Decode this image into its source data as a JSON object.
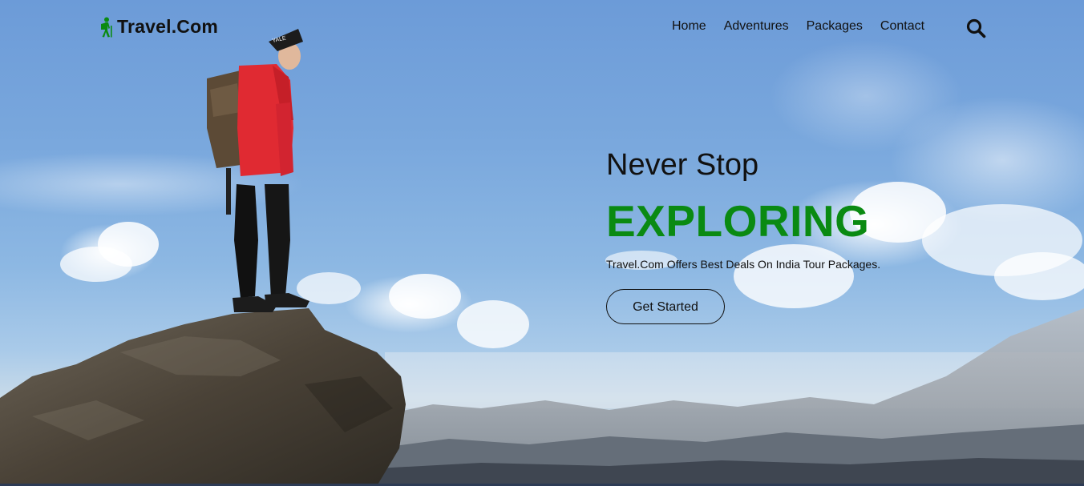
{
  "brand": {
    "name": "Travel.Com",
    "icon": "hiker-icon"
  },
  "nav": {
    "links": [
      "Home",
      "Adventures",
      "Packages",
      "Contact"
    ],
    "search_icon": "search-icon"
  },
  "hero": {
    "title": "Never Stop",
    "accent": "EXPLORING",
    "description": "Travel.Com Offers Best Deals On India Tour Packages.",
    "cta_label": "Get Started"
  },
  "colors": {
    "accent": "#0a8a12",
    "text": "#111111",
    "jacket": "#e02a32"
  }
}
